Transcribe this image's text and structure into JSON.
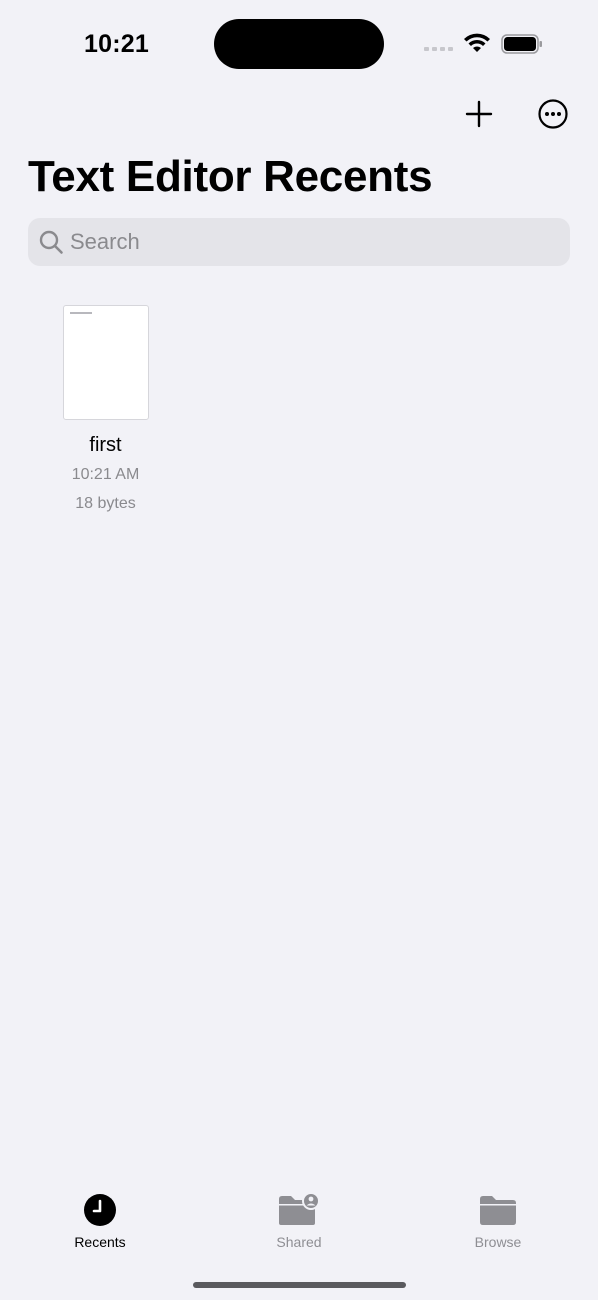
{
  "status_bar": {
    "time": "10:21"
  },
  "toolbar": {
    "add_icon": "plus-icon",
    "more_icon": "ellipsis-circle-icon"
  },
  "header": {
    "title": "Text Editor Recents"
  },
  "search": {
    "placeholder": "Search",
    "value": ""
  },
  "documents": [
    {
      "name": "first",
      "time": "10:21 AM",
      "size": "18 bytes"
    }
  ],
  "tabs": [
    {
      "label": "Recents",
      "icon": "clock-icon",
      "active": true
    },
    {
      "label": "Shared",
      "icon": "shared-folder-icon",
      "active": false
    },
    {
      "label": "Browse",
      "icon": "folder-icon",
      "active": false
    }
  ],
  "colors": {
    "background": "#f2f2f7",
    "search_fill": "#e4e4e9",
    "secondary_text": "#8a8a8e",
    "inactive_tab": "#8e8e93"
  }
}
